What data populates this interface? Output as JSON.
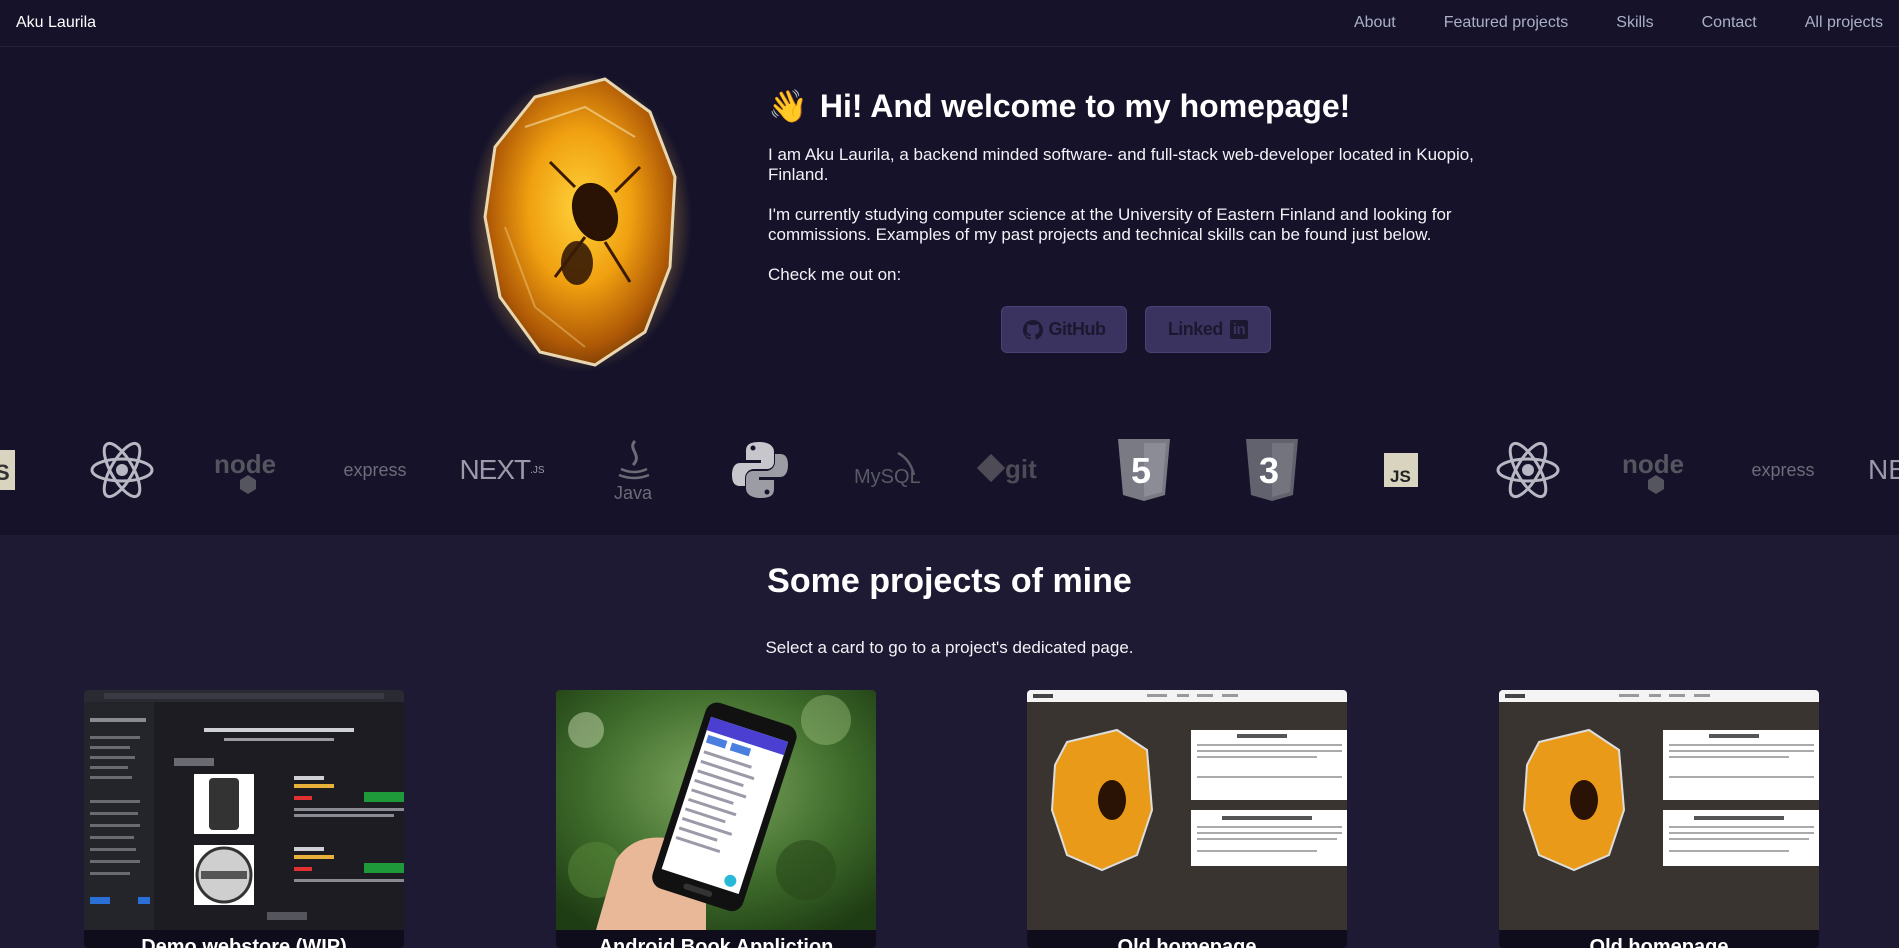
{
  "nav": {
    "brand": "Aku Laurila",
    "links": [
      "About",
      "Featured projects",
      "Skills",
      "Contact",
      "All projects"
    ]
  },
  "hero": {
    "title": "Hi! And welcome to my homepage!",
    "paragraph1": "I am Aku Laurila, a backend minded software- and full-stack web-developer located in Kuopio, Finland.",
    "paragraph2": "I'm currently studying computer science at the University of Eastern Finland and looking for commissions. Examples of my past projects and technical skills can be found just below.",
    "check_out": "Check me out on:",
    "github_label": "GitHub",
    "linkedin_label": "Linked",
    "linkedin_badge": "in"
  },
  "skills": {
    "express": "express",
    "next": "NEXT",
    "java": "Java",
    "mysql": "MySQL",
    "git": "git",
    "js": "JS",
    "html": "5",
    "css": "3",
    "node": "node"
  },
  "projects": {
    "title": "Some projects of mine",
    "subtitle": "Select a card to go to a project's dedicated page.",
    "cards": [
      {
        "title": "Demo webstore (WIP)"
      },
      {
        "title": "Android Book Appliction"
      },
      {
        "title": "Old homepage"
      },
      {
        "title": "Old homepage"
      }
    ]
  },
  "colors": {
    "background": "#1e1a33",
    "nav_bg": "#15122a",
    "button_bg": "#3a3360"
  }
}
